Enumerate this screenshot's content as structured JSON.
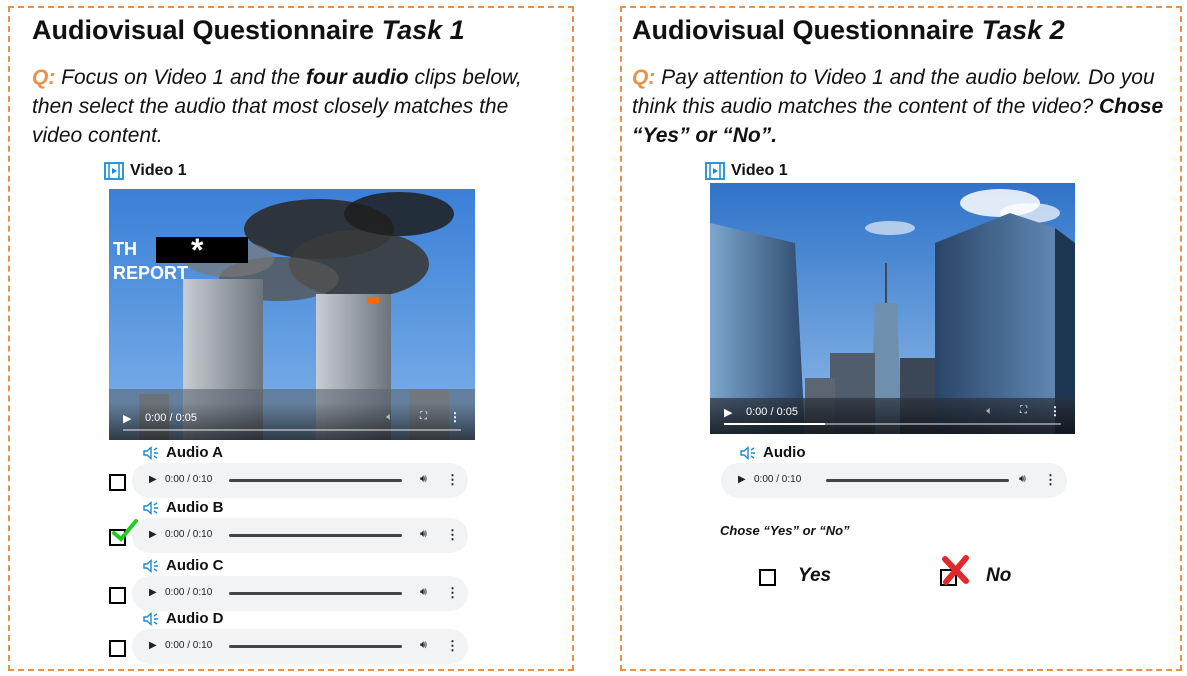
{
  "task1": {
    "title_main": "Audiovisual Questionnaire ",
    "title_task": "Task 1",
    "q_label": "Q:",
    "q_part1": " Focus on Video 1 and the ",
    "q_bold": "four audio",
    "q_part2": " clips below, then select the audio that most closely matches the video content.",
    "video_label": "Video 1",
    "video_overlay_line1": "TH",
    "video_overlay_star": "*",
    "video_overlay_line2": "REPORT",
    "video_time": "0:00 / 0:05",
    "video_progress": 0,
    "audios": [
      {
        "label": "Audio A",
        "time": "0:00 / 0:10",
        "checked": false
      },
      {
        "label": "Audio B",
        "time": "0:00 / 0:10",
        "checked": true
      },
      {
        "label": "Audio C",
        "time": "0:00 / 0:10",
        "checked": false
      },
      {
        "label": "Audio D",
        "time": "0:00 / 0:10",
        "checked": false
      }
    ]
  },
  "task2": {
    "title_main": "Audiovisual Questionnaire ",
    "title_task": "Task 2",
    "q_label": "Q:",
    "q_part1": " Pay attention to Video 1 and the audio below. Do you think this audio matches the content of the video? ",
    "q_bold": "Chose “Yes” or “No”.",
    "video_label": "Video 1",
    "video_time": "0:00 / 0:05",
    "video_progress": 0.3,
    "audio_label": "Audio",
    "audio_time": "0:00 / 0:10",
    "prompt": "Chose “Yes” or “No”",
    "option_yes": "Yes",
    "option_no": "No",
    "selected": "No"
  },
  "icons": {
    "video": "film-icon",
    "audio": "speaker-icon",
    "check": "green-checkmark-icon",
    "cross": "red-x-icon"
  },
  "colors": {
    "border": "#e8914a",
    "q_label": "#e8914a",
    "icon_blue": "#1a8ad6",
    "check": "#22cc22",
    "cross": "#e02a2a",
    "player_bg": "#f1f3f4"
  }
}
